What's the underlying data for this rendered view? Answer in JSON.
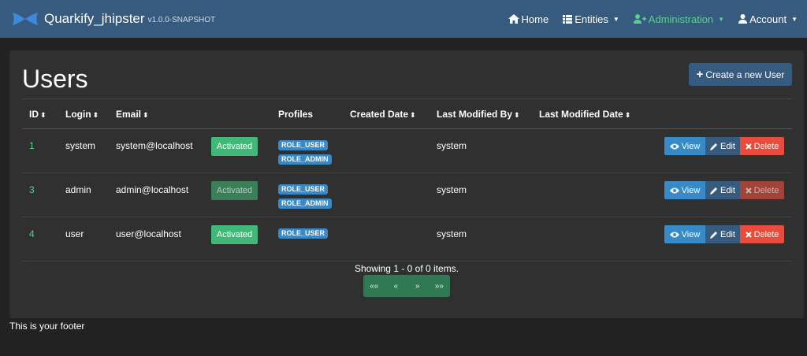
{
  "navbar": {
    "brand": "Quarkify_jhipster",
    "version": "v1.0.0-SNAPSHOT",
    "items": [
      {
        "label": "Home",
        "icon": "home-icon"
      },
      {
        "label": "Entities",
        "icon": "th-list-icon"
      },
      {
        "label": "Administration",
        "icon": "user-plus-icon"
      },
      {
        "label": "Account",
        "icon": "user-icon"
      }
    ],
    "active_color": "#5ad08f"
  },
  "page": {
    "title": "Users",
    "create_button": "Create a new User"
  },
  "table": {
    "headers": [
      "ID",
      "Login",
      "Email",
      "Profiles",
      "Created Date",
      "Last Modified By",
      "Last Modified Date"
    ],
    "rows": [
      {
        "id": "1",
        "login": "system",
        "email": "system@localhost",
        "status": "Activated",
        "roles": [
          "ROLE_USER",
          "ROLE_ADMIN"
        ],
        "created_date": "",
        "modified_by": "system",
        "modified_date": ""
      },
      {
        "id": "3",
        "login": "admin",
        "email": "admin@localhost",
        "status": "Activated",
        "roles": [
          "ROLE_USER",
          "ROLE_ADMIN"
        ],
        "created_date": "",
        "modified_by": "system",
        "modified_date": ""
      },
      {
        "id": "4",
        "login": "user",
        "email": "user@localhost",
        "status": "Activated",
        "roles": [
          "ROLE_USER"
        ],
        "created_date": "",
        "modified_by": "system",
        "modified_date": ""
      }
    ],
    "actions": {
      "view": "View",
      "edit": "Edit",
      "delete": "Delete"
    }
  },
  "pagination": {
    "info": "Showing 1 - 0 of 0 items.",
    "buttons": [
      "««",
      "«",
      "»",
      "»»"
    ]
  },
  "footer": "This is your footer",
  "colors": {
    "navbar": "#375a7f",
    "background": "#222222",
    "card": "#303030",
    "success": "#41b878",
    "info": "#3789c8",
    "danger": "#e74c3c"
  }
}
